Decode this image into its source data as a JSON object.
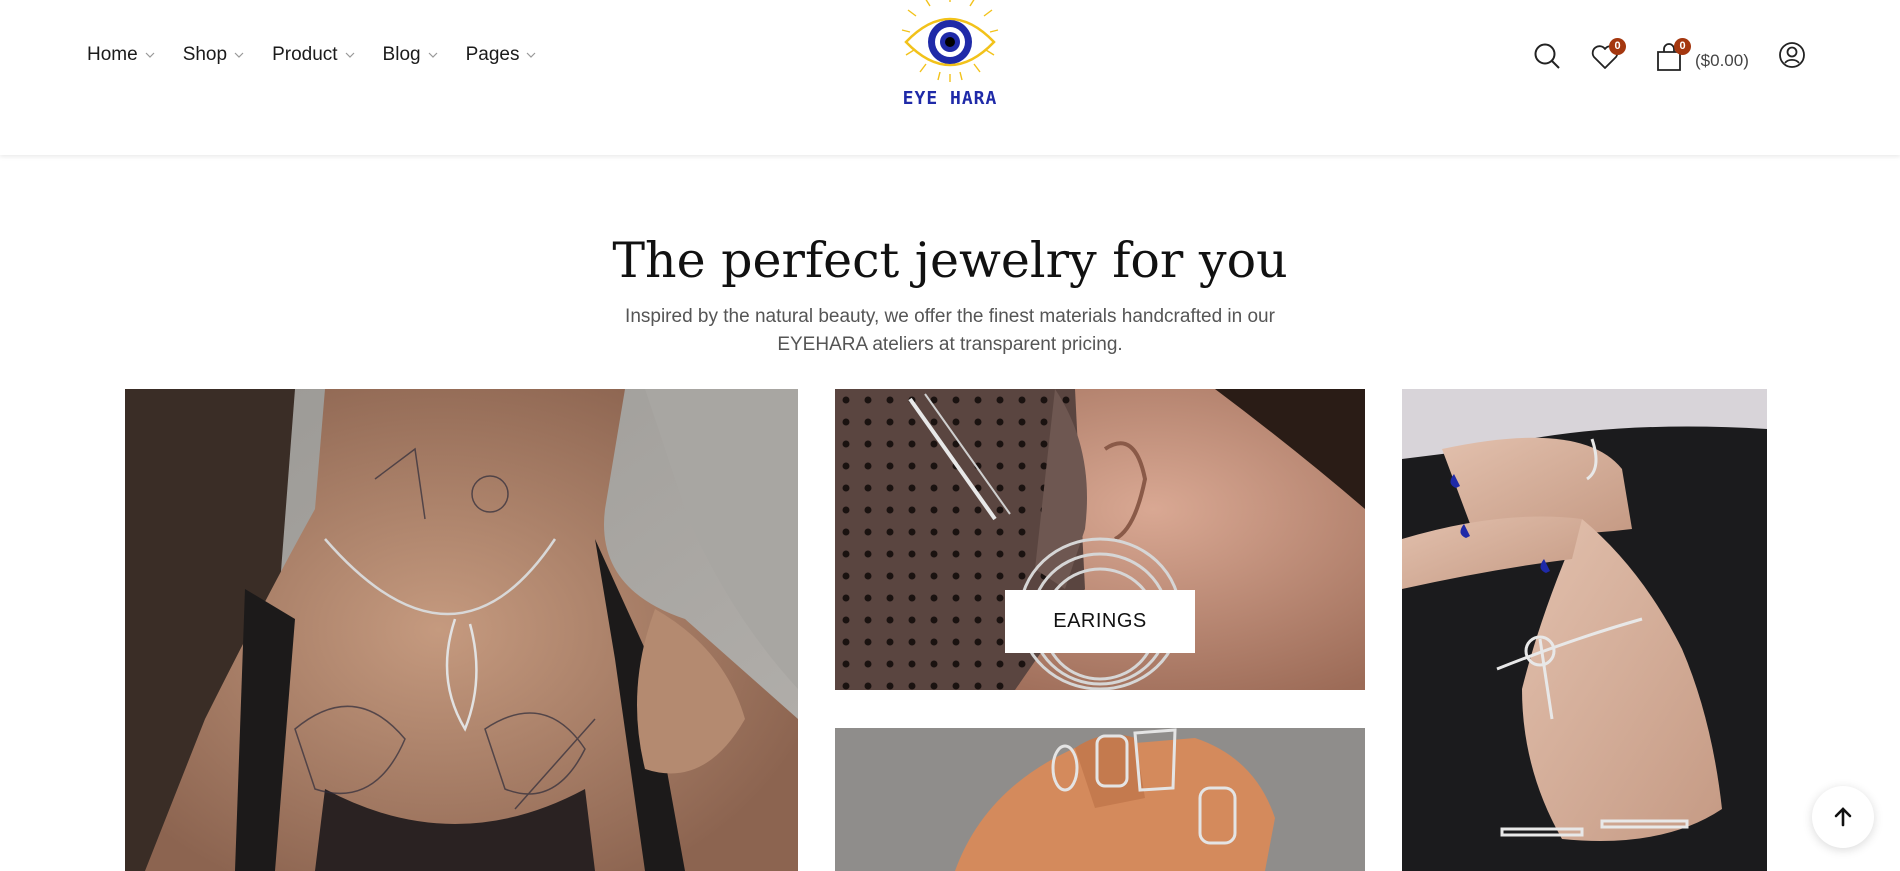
{
  "brand": {
    "name": "EYE HARA",
    "colors": {
      "ring_yellow": "#f2c21a",
      "iris_blue": "#1f2aa8",
      "badge": "#a4370f"
    }
  },
  "nav": {
    "items": [
      {
        "label": "Home",
        "icon": "chevron-down-icon"
      },
      {
        "label": "Shop",
        "icon": "chevron-down-icon"
      },
      {
        "label": "Product",
        "icon": "chevron-down-icon"
      },
      {
        "label": "Blog",
        "icon": "chevron-down-icon"
      },
      {
        "label": "Pages",
        "icon": "chevron-down-icon"
      }
    ]
  },
  "header_icons": {
    "search": "search-icon",
    "wishlist": {
      "icon": "heart-icon",
      "count": "0"
    },
    "cart": {
      "icon": "shopping-bag-icon",
      "count": "0",
      "total": "($0.00)"
    },
    "account": "user-icon"
  },
  "hero": {
    "title": "The perfect jewelry for you",
    "subtitle": "Inspired by the natural beauty, we offer the finest materials handcrafted in our EYEHARA ateliers at transparent pricing."
  },
  "gallery": {
    "tiles": [
      {
        "subject": "necklace model photo"
      },
      {
        "subject": "earrings model photo",
        "label": "EARINGS"
      },
      {
        "subject": "rings hand photo"
      },
      {
        "subject": "bracelet and rings hand photo"
      }
    ]
  },
  "scroll_top": {
    "icon": "arrow-up-icon"
  }
}
